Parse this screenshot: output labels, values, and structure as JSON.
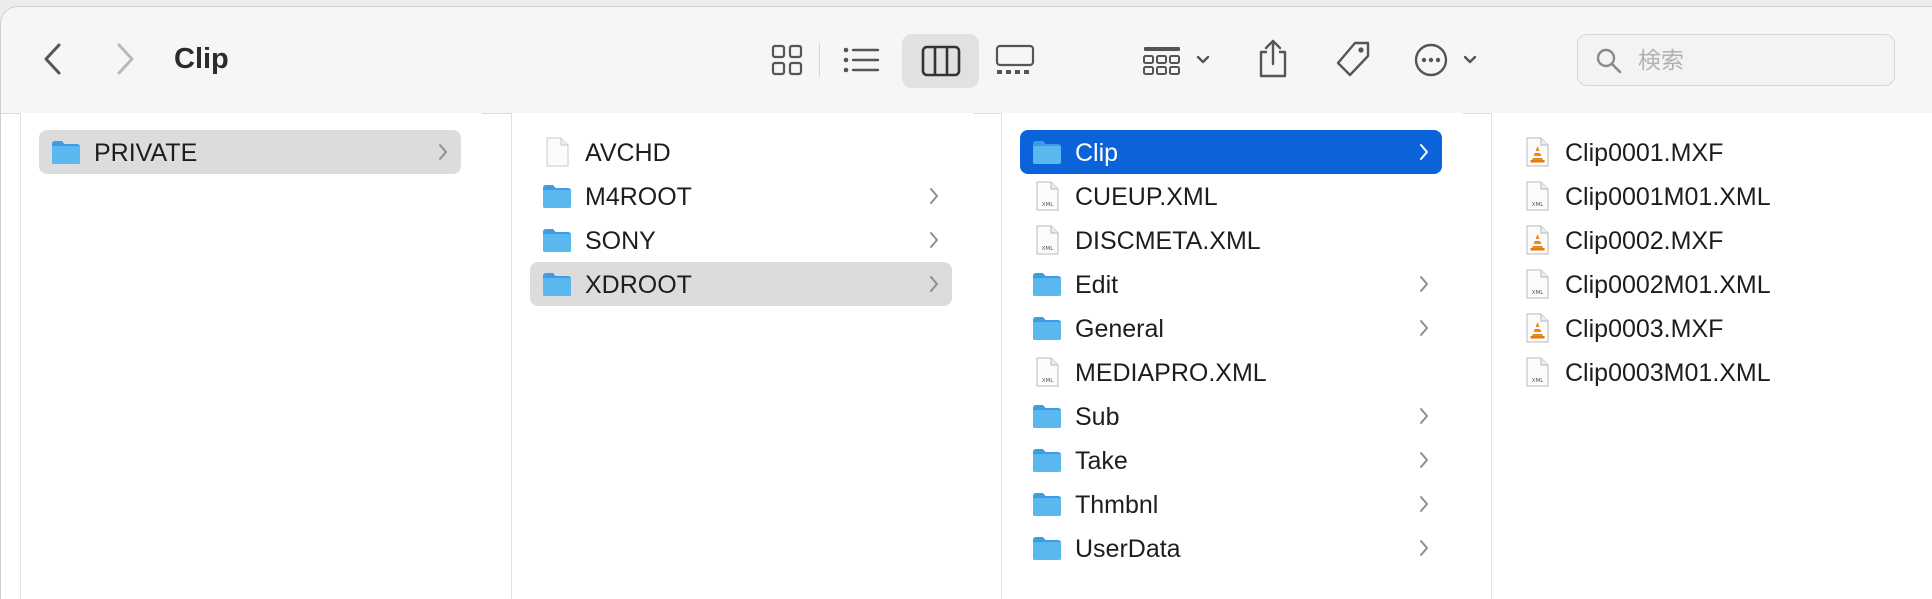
{
  "window": {
    "title": "Clip"
  },
  "search": {
    "placeholder": "検索"
  },
  "toolbar": {
    "icons": [
      "chevron-left-icon",
      "chevron-right-icon",
      "grid-view-icon",
      "list-view-icon",
      "column-view-icon",
      "gallery-view-icon",
      "group-icon",
      "share-icon",
      "tag-icon",
      "ellipsis-circle-icon"
    ],
    "active_view": "columns"
  },
  "colors": {
    "selection_blue": "#0a63d8",
    "selection_gray": "#dcdcdc",
    "folder_blue": "#5ab8ef"
  },
  "columns": [
    {
      "items": [
        {
          "label": "PRIVATE",
          "type": "folder",
          "selected": "gray"
        }
      ]
    },
    {
      "items": [
        {
          "label": "AVCHD",
          "type": "file"
        },
        {
          "label": "M4ROOT",
          "type": "folder"
        },
        {
          "label": "SONY",
          "type": "folder"
        },
        {
          "label": "XDROOT",
          "type": "folder",
          "selected": "gray"
        }
      ]
    },
    {
      "items": [
        {
          "label": "Clip",
          "type": "folder",
          "selected": "blue"
        },
        {
          "label": "CUEUP.XML",
          "type": "xml"
        },
        {
          "label": "DISCMETA.XML",
          "type": "xml"
        },
        {
          "label": "Edit",
          "type": "folder"
        },
        {
          "label": "General",
          "type": "folder"
        },
        {
          "label": "MEDIAPRO.XML",
          "type": "xml"
        },
        {
          "label": "Sub",
          "type": "folder"
        },
        {
          "label": "Take",
          "type": "folder"
        },
        {
          "label": "Thmbnl",
          "type": "folder"
        },
        {
          "label": "UserData",
          "type": "folder"
        }
      ]
    },
    {
      "items": [
        {
          "label": "Clip0001.MXF",
          "type": "vlc"
        },
        {
          "label": "Clip0001M01.XML",
          "type": "xml"
        },
        {
          "label": "Clip0002.MXF",
          "type": "vlc"
        },
        {
          "label": "Clip0002M01.XML",
          "type": "xml"
        },
        {
          "label": "Clip0003.MXF",
          "type": "vlc"
        },
        {
          "label": "Clip0003M01.XML",
          "type": "xml"
        }
      ]
    }
  ]
}
